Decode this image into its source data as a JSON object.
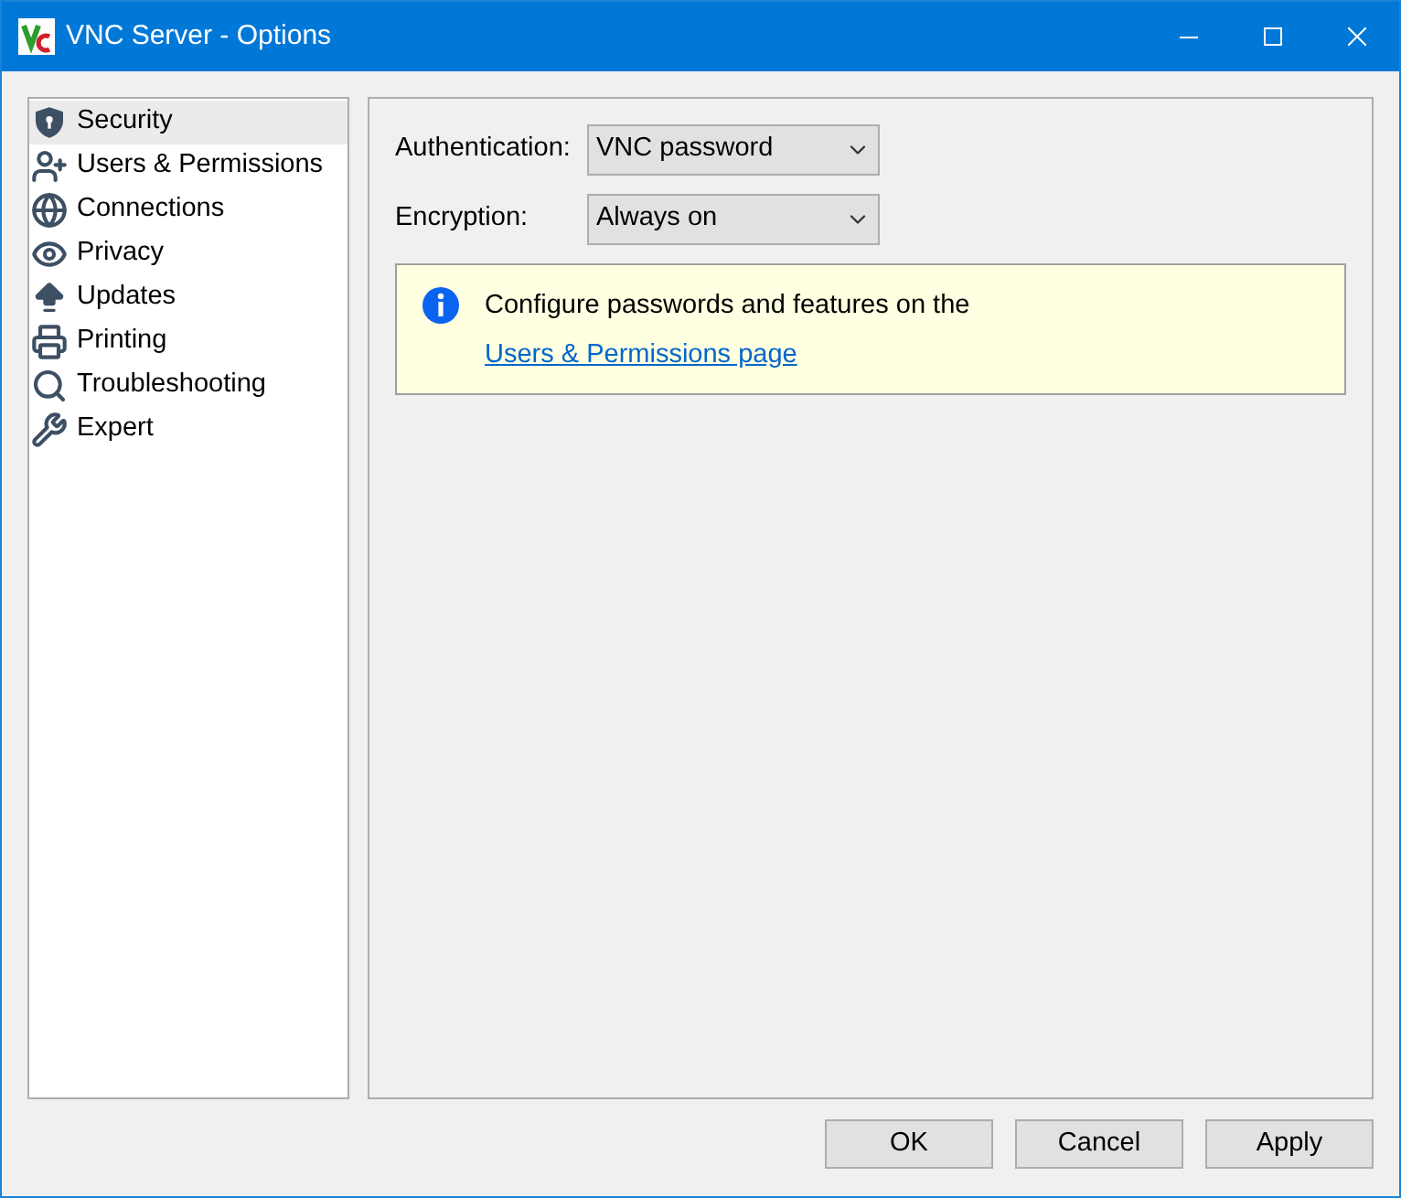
{
  "window": {
    "title": "VNC Server - Options"
  },
  "sidebar": {
    "items": [
      {
        "label": "Security",
        "selected": true
      },
      {
        "label": "Users & Permissions",
        "selected": false
      },
      {
        "label": "Connections",
        "selected": false
      },
      {
        "label": "Privacy",
        "selected": false
      },
      {
        "label": "Updates",
        "selected": false
      },
      {
        "label": "Printing",
        "selected": false
      },
      {
        "label": "Troubleshooting",
        "selected": false
      },
      {
        "label": "Expert",
        "selected": false
      }
    ]
  },
  "form": [
    {
      "label": "Authentication:",
      "value": "VNC password"
    },
    {
      "label": "Encryption:",
      "value": "Always on"
    }
  ],
  "info": {
    "text": "Configure passwords and features on the",
    "link": "Users & Permissions page"
  },
  "buttons": [
    "OK",
    "Cancel",
    "Apply"
  ]
}
